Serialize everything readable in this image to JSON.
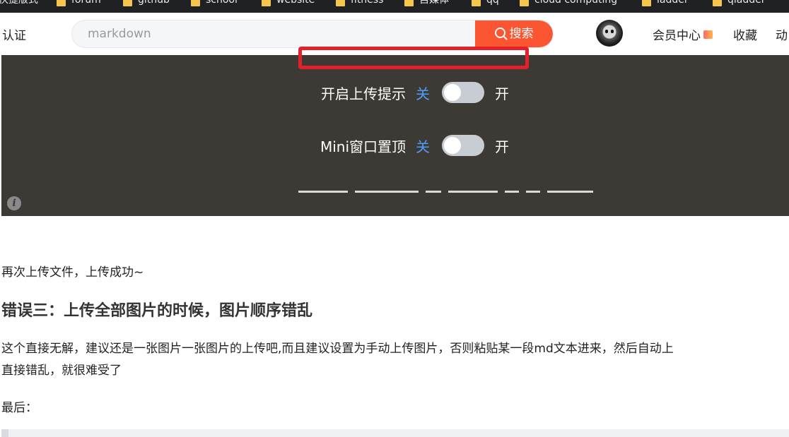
{
  "bookmarks": [
    "快捷版式",
    "forum",
    "github",
    "school",
    "website",
    "fitness",
    "自媒体",
    "qq",
    "cloud computing",
    "ladder",
    "qladder"
  ],
  "header": {
    "left_label": "认证",
    "search": {
      "placeholder": "markdown",
      "button_label": "搜索"
    },
    "nav": {
      "member_center": "会员中心",
      "favorites": "收藏",
      "dynamic": "动"
    }
  },
  "screenshot_panel": {
    "rows": [
      {
        "label": "开启上传提示",
        "off": "关",
        "on": "开",
        "enabled": false
      },
      {
        "label": "Mini窗口置顶",
        "off": "关",
        "on": "开",
        "enabled": false
      }
    ],
    "info_icon": "i"
  },
  "article": {
    "para1": "再次上传文件，上传成功~",
    "heading": "错误三：上传全部图片的时候，图片顺序错乱",
    "para2_line1": "这个直接无解，建议还是一张图片一张图片的上传吧,而且建议设置为手动上传图片，否则粘贴某一段md文本进来，然后自动上",
    "para2_line2": "直接错乱，就很难受了",
    "para3": "最后："
  },
  "colors": {
    "accent": "#fc5531",
    "panel_bg": "#3d3a35",
    "toggle_off_label": "#4d9ef8",
    "highlight_frame": "#e5202a"
  },
  "icons": [
    "folder-icon",
    "search-icon",
    "avatar",
    "gift-icon",
    "info-icon"
  ]
}
